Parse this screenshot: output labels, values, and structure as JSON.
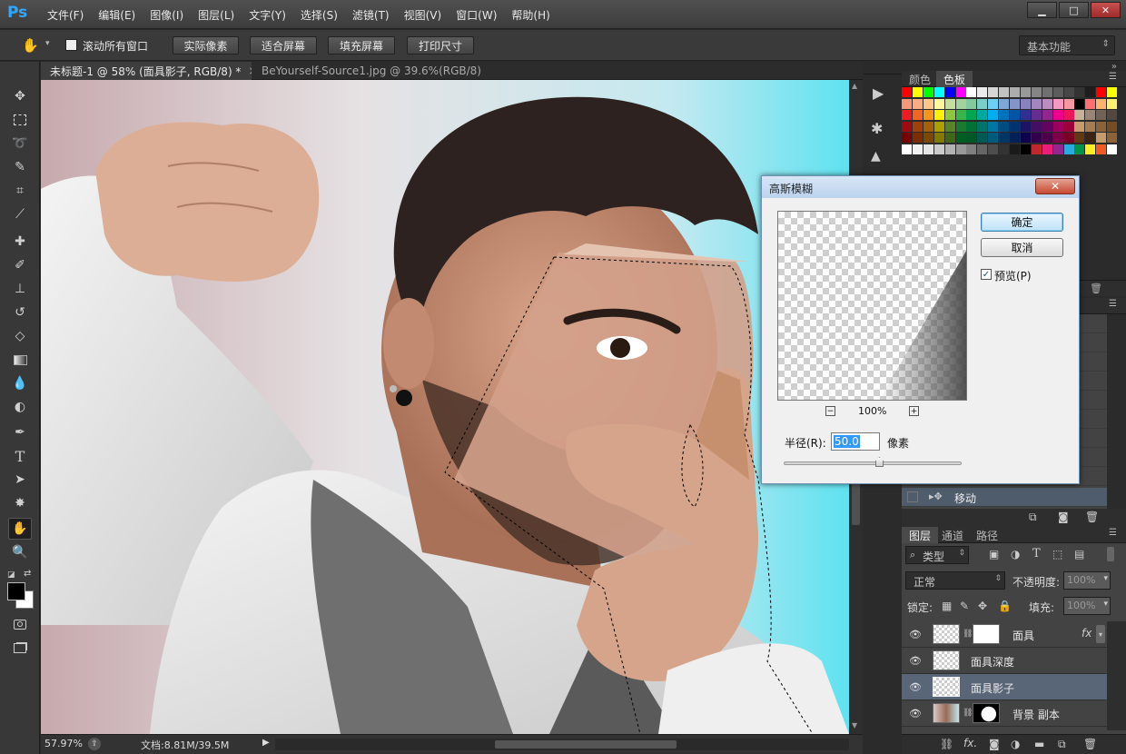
{
  "app": {
    "logo": "Ps",
    "window_min": "▁",
    "window_max": "□",
    "window_close": "✕"
  },
  "menu": [
    "文件(F)",
    "编辑(E)",
    "图像(I)",
    "图层(L)",
    "文字(Y)",
    "选择(S)",
    "滤镜(T)",
    "视图(V)",
    "窗口(W)",
    "帮助(H)"
  ],
  "options": {
    "scroll_all_label": "滚动所有窗口",
    "buttons": [
      "实际像素",
      "适合屏幕",
      "填充屏幕",
      "打印尺寸"
    ],
    "workspace": "基本功能"
  },
  "tabs": [
    {
      "label": "未标题-1 @ 58% (面具影子, RGB/8) *",
      "close": "×"
    },
    {
      "label": "BeYourself-Source1.jpg @ 39.6%(RGB/8) *",
      "close": "×"
    }
  ],
  "status": {
    "zoom": "57.97%",
    "doc": "文档:8.81M/39.5M"
  },
  "swatch_panel": {
    "tabs": [
      "颜色",
      "色板"
    ]
  },
  "actions_panel": {
    "item": "移动"
  },
  "layers_panel": {
    "tabs": [
      "图层",
      "通道",
      "路径"
    ],
    "filter_label": "类型",
    "blend_mode": "正常",
    "opacity_label": "不透明度:",
    "opacity_value": "100%",
    "lock_label": "锁定:",
    "fill_label": "填充:",
    "fill_value": "100%",
    "layers": [
      {
        "name": "面具",
        "fx": "fx"
      },
      {
        "name": "面具深度"
      },
      {
        "name": "面具影子"
      },
      {
        "name": "背景 副本"
      }
    ]
  },
  "dialog": {
    "title": "高斯模糊",
    "ok": "确定",
    "cancel": "取消",
    "preview_label": "预览(P)",
    "preview_checked": true,
    "zoom": "100%",
    "zoom_minus": "−",
    "zoom_plus": "+",
    "radius_label": "半径(R):",
    "radius_value": "50.0",
    "radius_unit": "像素"
  }
}
